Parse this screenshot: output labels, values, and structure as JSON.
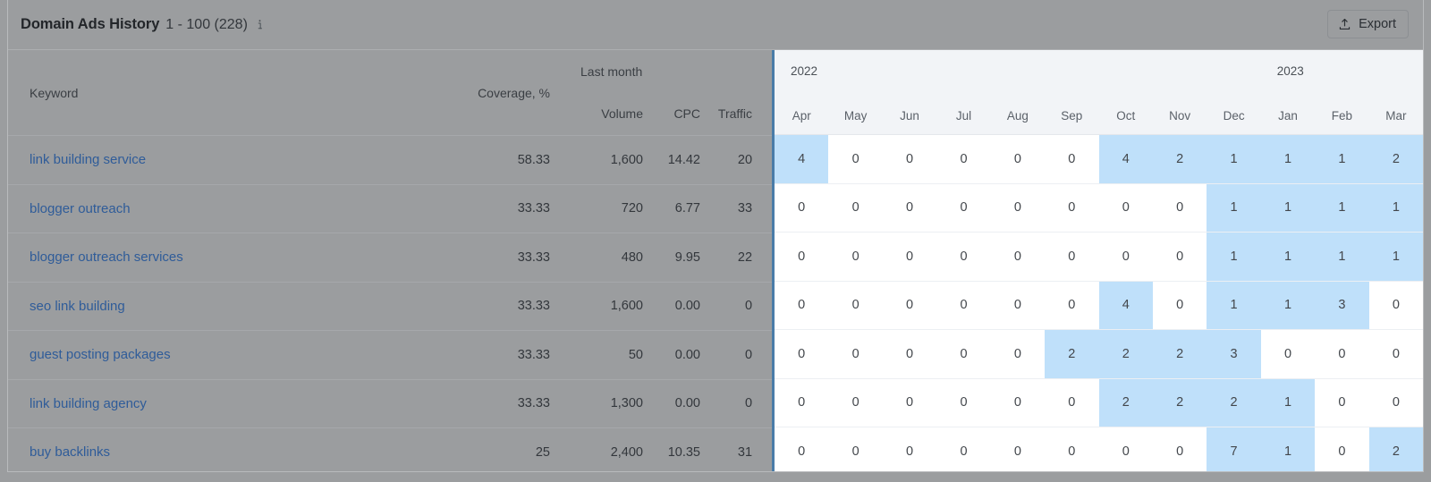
{
  "header": {
    "title": "Domain Ads History",
    "range": "1 - 100 (228)",
    "info_icon": "info-icon",
    "export_label": "Export",
    "export_icon": "upload-icon"
  },
  "table": {
    "headers": {
      "keyword": "Keyword",
      "coverage": "Coverage, %",
      "last_month": "Last month",
      "volume": "Volume",
      "cpc": "CPC",
      "traffic": "Traffic"
    },
    "rows": [
      {
        "keyword": "link building service",
        "coverage": "58.33",
        "volume": "1,600",
        "cpc": "14.42",
        "traffic": "20"
      },
      {
        "keyword": "blogger outreach",
        "coverage": "33.33",
        "volume": "720",
        "cpc": "6.77",
        "traffic": "33"
      },
      {
        "keyword": "blogger outreach services",
        "coverage": "33.33",
        "volume": "480",
        "cpc": "9.95",
        "traffic": "22"
      },
      {
        "keyword": "seo link building",
        "coverage": "33.33",
        "volume": "1,600",
        "cpc": "0.00",
        "traffic": "0"
      },
      {
        "keyword": "guest posting packages",
        "coverage": "33.33",
        "volume": "50",
        "cpc": "0.00",
        "traffic": "0"
      },
      {
        "keyword": "link building agency",
        "coverage": "33.33",
        "volume": "1,300",
        "cpc": "0.00",
        "traffic": "0"
      },
      {
        "keyword": "buy backlinks",
        "coverage": "25",
        "volume": "2,400",
        "cpc": "10.35",
        "traffic": "31"
      }
    ]
  },
  "timeline": {
    "years": [
      {
        "label": "2022",
        "start_index": 0,
        "span": 9
      },
      {
        "label": "2023",
        "start_index": 9,
        "span": 3
      }
    ],
    "months": [
      "Apr",
      "May",
      "Jun",
      "Jul",
      "Aug",
      "Sep",
      "Oct",
      "Nov",
      "Dec",
      "Jan",
      "Feb",
      "Mar"
    ],
    "highlight_color": "#bfe0fa",
    "rows": [
      {
        "values": [
          "4",
          "0",
          "0",
          "0",
          "0",
          "0",
          "4",
          "2",
          "1",
          "1",
          "1",
          "2"
        ],
        "active": [
          true,
          false,
          false,
          false,
          false,
          false,
          true,
          true,
          true,
          true,
          true,
          true
        ]
      },
      {
        "values": [
          "0",
          "0",
          "0",
          "0",
          "0",
          "0",
          "0",
          "0",
          "1",
          "1",
          "1",
          "1"
        ],
        "active": [
          false,
          false,
          false,
          false,
          false,
          false,
          false,
          false,
          true,
          true,
          true,
          true
        ]
      },
      {
        "values": [
          "0",
          "0",
          "0",
          "0",
          "0",
          "0",
          "0",
          "0",
          "1",
          "1",
          "1",
          "1"
        ],
        "active": [
          false,
          false,
          false,
          false,
          false,
          false,
          false,
          false,
          true,
          true,
          true,
          true
        ]
      },
      {
        "values": [
          "0",
          "0",
          "0",
          "0",
          "0",
          "0",
          "4",
          "0",
          "1",
          "1",
          "3",
          "0"
        ],
        "active": [
          false,
          false,
          false,
          false,
          false,
          false,
          true,
          false,
          true,
          true,
          true,
          false
        ]
      },
      {
        "values": [
          "0",
          "0",
          "0",
          "0",
          "0",
          "2",
          "2",
          "2",
          "3",
          "0",
          "0",
          "0"
        ],
        "active": [
          false,
          false,
          false,
          false,
          false,
          true,
          true,
          true,
          true,
          false,
          false,
          false
        ]
      },
      {
        "values": [
          "0",
          "0",
          "0",
          "0",
          "0",
          "0",
          "2",
          "2",
          "2",
          "1",
          "0",
          "0"
        ],
        "active": [
          false,
          false,
          false,
          false,
          false,
          false,
          true,
          true,
          true,
          true,
          false,
          false
        ]
      },
      {
        "values": [
          "0",
          "0",
          "0",
          "0",
          "0",
          "0",
          "0",
          "0",
          "7",
          "1",
          "0",
          "2"
        ],
        "active": [
          false,
          false,
          false,
          false,
          false,
          false,
          false,
          false,
          true,
          true,
          false,
          true
        ]
      }
    ]
  }
}
